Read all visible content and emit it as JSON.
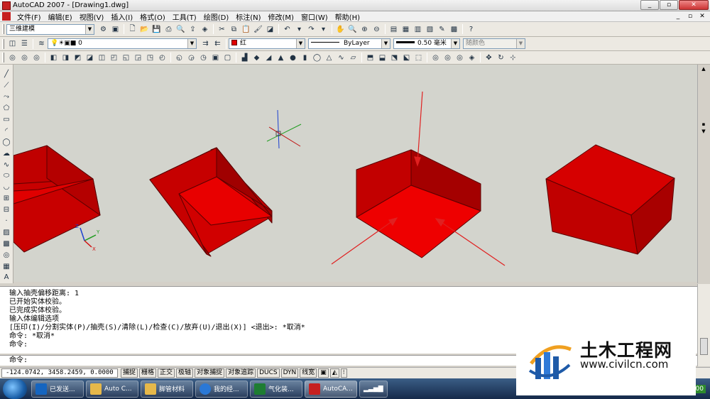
{
  "window": {
    "title": "AutoCAD 2007 - [Drawing1.dwg]",
    "min_label": "_",
    "restore_label": "▫",
    "close_label": "✕"
  },
  "menu": {
    "items": [
      "文件(F)",
      "编辑(E)",
      "视图(V)",
      "插入(I)",
      "格式(O)",
      "工具(T)",
      "绘图(D)",
      "标注(N)",
      "修改(M)",
      "窗口(W)",
      "帮助(H)"
    ]
  },
  "toolbars": {
    "workspace": "三维建模",
    "layer": "0",
    "color": "红",
    "linetype": "ByLayer",
    "lineweight": "0.50 毫米",
    "plotstyle": "随颜色"
  },
  "command": {
    "history": [
      "输入抽壳偏移距离: 1",
      "已开始实体校验。",
      "已完成实体校验。",
      "输入体编辑选项",
      "[压印(I)/分割实体(P)/抽壳(S)/清除(L)/检查(C)/放弃(U)/退出(X)] <退出>: *取消*",
      "命令: *取消*",
      "命令:"
    ],
    "prompt": "命令:"
  },
  "status": {
    "coords": "-124.0742,  3458.2459, 0.0000",
    "toggles": [
      {
        "label": "捕捉",
        "on": false
      },
      {
        "label": "栅格",
        "on": false
      },
      {
        "label": "正交",
        "on": false
      },
      {
        "label": "极轴",
        "on": false
      },
      {
        "label": "对象捕捉",
        "on": false
      },
      {
        "label": "对象追踪",
        "on": false
      },
      {
        "label": "DUCS",
        "on": false
      },
      {
        "label": "DYN",
        "on": false
      },
      {
        "label": "线宽",
        "on": false
      }
    ]
  },
  "taskbar": {
    "items": [
      {
        "label": "已发送...",
        "icon": "#1565c0"
      },
      {
        "label": "Auto C...",
        "icon": "#e6b84a"
      },
      {
        "label": "脚管材料",
        "icon": "#e6b84a"
      },
      {
        "label": "我的经...",
        "icon": "#2a78d6"
      },
      {
        "label": "气化装...",
        "icon": "#1e7d32"
      },
      {
        "label": "AutoCA...",
        "icon": "#c62020"
      }
    ],
    "tray_text": "100"
  },
  "watermark": {
    "title": "土木工程网",
    "url": "www.civilcn.com"
  },
  "colors": {
    "solid": "#c80000",
    "solid_dark": "#a00000",
    "canvas": "#d3d4cd"
  }
}
